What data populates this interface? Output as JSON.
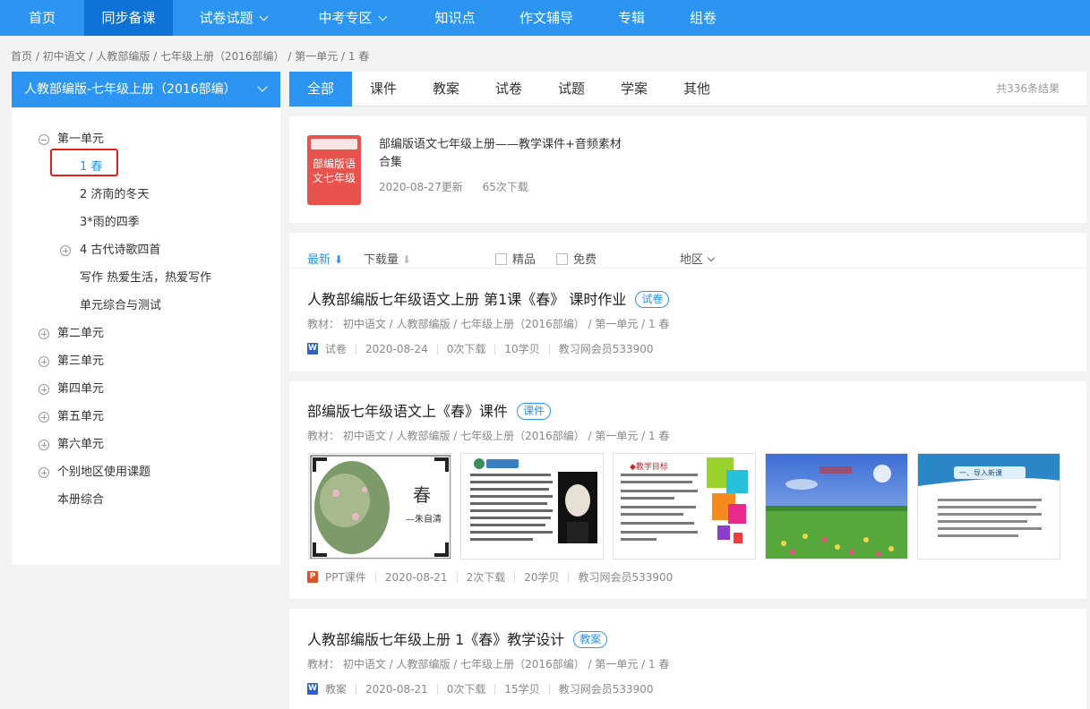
{
  "nav": {
    "items": [
      {
        "label": "首页"
      },
      {
        "label": "同步备课"
      },
      {
        "label": "试卷试题"
      },
      {
        "label": "中考专区"
      },
      {
        "label": "知识点"
      },
      {
        "label": "作文辅导"
      },
      {
        "label": "专辑"
      },
      {
        "label": "组卷"
      }
    ],
    "active": "同步备课"
  },
  "breadcrumb": "首页 / 初中语文 / 人教部编版 / 七年级上册（2016部编） / 第一单元 / 1 春",
  "sidebar": {
    "title": "人教部编版-七年级上册（2016部编）",
    "tree": [
      {
        "label": "第一单元"
      },
      {
        "label": "1 春"
      },
      {
        "label": "2 济南的冬天"
      },
      {
        "label": "3*雨的四季"
      },
      {
        "label": "4 古代诗歌四首"
      },
      {
        "label": "写作 热爱生活，热爱写作"
      },
      {
        "label": "单元综合与测试"
      },
      {
        "label": "第二单元"
      },
      {
        "label": "第三单元"
      },
      {
        "label": "第四单元"
      },
      {
        "label": "第五单元"
      },
      {
        "label": "第六单元"
      },
      {
        "label": "个别地区使用课题"
      },
      {
        "label": "本册综合"
      }
    ]
  },
  "tabs": {
    "items": [
      {
        "label": "全部"
      },
      {
        "label": "课件"
      },
      {
        "label": "教案"
      },
      {
        "label": "试卷"
      },
      {
        "label": "试题"
      },
      {
        "label": "学案"
      },
      {
        "label": "其他"
      }
    ],
    "count": "共336条结果"
  },
  "featured": {
    "cover_text": "部编版语文七年级",
    "title": "部编版语文七年级上册——教学课件+音频素材合集",
    "title_line1": "部编版语文七年级上册——教学课件+音频素材",
    "title_line2": "合集",
    "updated": "2020-08-27更新",
    "downloads": "65次下载"
  },
  "filters": {
    "newest": "最新",
    "downloads": "下载量",
    "quality": "精品",
    "free": "免费",
    "region": "地区"
  },
  "results": [
    {
      "title": "人教部编版七年级语文上册 第1课《春》 课时作业",
      "badge": "试卷",
      "path": "教材： 初中语文 / 人教部编版 / 七年级上册（2016部编） / 第一单元 / 1 春",
      "type": "试卷",
      "date": "2020-08-24",
      "downloads": "0次下载",
      "points": "10学贝",
      "author": "教习网会员533900"
    },
    {
      "title": "部编版七年级语文上《春》课件",
      "badge": "课件",
      "path": "教材： 初中语文 / 人教部编版 / 七年级上册（2016部编） / 第一单元 / 1 春",
      "thumb1_char": "春",
      "thumb1_author": "—朱自清",
      "thumb3_text": "◆教学目标",
      "thumb5_text": "一、导入新课",
      "type": "PPT课件",
      "date": "2020-08-21",
      "downloads": "2次下载",
      "points": "20学贝",
      "author": "教习网会员533900"
    },
    {
      "title": "人教部编版七年级上册 1《春》教学设计",
      "badge": "教案",
      "path": "教材： 初中语文 / 人教部编版 / 七年级上册（2016部编） / 第一单元 / 1 春",
      "type": "教案",
      "date": "2020-08-21",
      "downloads": "0次下载",
      "points": "15学贝",
      "author": "教习网会员533900"
    }
  ],
  "colors": {
    "brand": "#2b95f1",
    "nav_active": "#0f72d6",
    "selection_border": "#e0201b"
  }
}
